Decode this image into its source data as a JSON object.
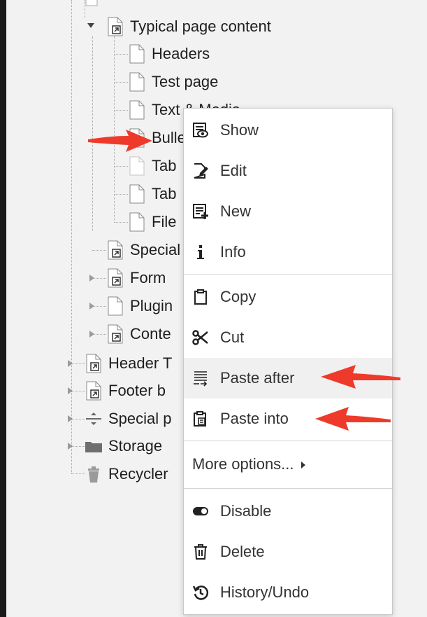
{
  "tree": {
    "items": [
      {
        "label": "Typical page content"
      },
      {
        "label": "Headers"
      },
      {
        "label": "Test page"
      },
      {
        "label": "Text & Media"
      },
      {
        "label": "Bullet"
      },
      {
        "label": "Tab"
      },
      {
        "label": "Tab"
      },
      {
        "label": "File"
      },
      {
        "label": "Special"
      },
      {
        "label": "Form"
      },
      {
        "label": "Plugin"
      },
      {
        "label": "Conte"
      },
      {
        "label": "Header T"
      },
      {
        "label": "Footer b"
      },
      {
        "label": "Special p"
      },
      {
        "label": "Storage"
      },
      {
        "label": "Recycler"
      }
    ]
  },
  "context_menu": {
    "items": [
      {
        "label": "Show",
        "icon": "show-icon"
      },
      {
        "label": "Edit",
        "icon": "edit-icon"
      },
      {
        "label": "New",
        "icon": "new-icon"
      },
      {
        "label": "Info",
        "icon": "info-icon"
      },
      {
        "label": "Copy",
        "icon": "copy-icon"
      },
      {
        "label": "Cut",
        "icon": "scissors-icon"
      },
      {
        "label": "Paste after",
        "icon": "paste-after-icon"
      },
      {
        "label": "Paste into",
        "icon": "paste-into-icon"
      },
      {
        "label": "More options...",
        "icon": "caret-right-icon"
      },
      {
        "label": "Disable",
        "icon": "toggle-icon"
      },
      {
        "label": "Delete",
        "icon": "trash-icon"
      },
      {
        "label": "History/Undo",
        "icon": "history-icon"
      }
    ]
  },
  "colors": {
    "annotation_arrow": "#ee3a2a",
    "tree_background": "#f2f2f2",
    "menu_background": "#ffffff",
    "hover_row": "#f0f0f0"
  }
}
